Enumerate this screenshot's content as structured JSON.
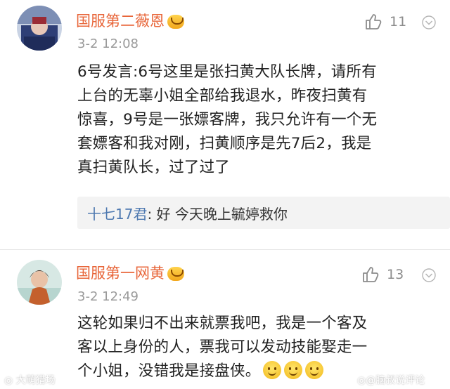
{
  "comments": [
    {
      "username": "国服第二薇恩",
      "time": "3-2 12:08",
      "likes": "11",
      "text_lines": [
        "6号发言:6号这里是张扫黄大队长牌，请所有",
        "上台的无辜小姐全部给我退水，昨夜扫黄有",
        "惊喜，9号是一张嫖客牌，我只允许有一个无",
        "套嫖客和我对刚，扫黄顺序是先7后2，我是",
        "真扫黄队长，过了过了"
      ],
      "reply": {
        "user": "十七17君",
        "text": ": 好 今天晚上毓婷救你"
      }
    },
    {
      "username": "国服第一网黄",
      "time": "3-2 12:49",
      "likes": "13",
      "text_lines": [
        "这轮如果归不出来就票我吧，我是一个客及",
        "客以上身份的人，票我可以发动技能娶走一",
        "个小姐，没错我是接盘侠。"
      ]
    }
  ],
  "watermarks": {
    "left": "大萌猎场",
    "right": "@脑叔说评论"
  },
  "icons": {
    "like": "thumbs-up-icon",
    "menu": "chevron-down-icon",
    "badge": "vip-crown-icon",
    "emoji": "smiley-icon"
  },
  "colors": {
    "username": "#e8663a",
    "reply_user": "#4d78b0",
    "time": "#9a9a9a",
    "reply_bg": "#f3f3f3"
  }
}
